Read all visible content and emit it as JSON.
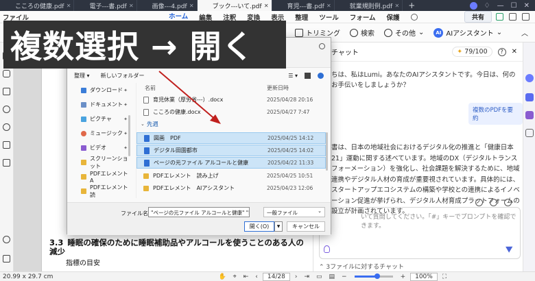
{
  "tabs": [
    {
      "label": "こころの健康.pdf",
      "active": false
    },
    {
      "label": "電子---書.pdf",
      "active": false
    },
    {
      "label": "画像---4.pdf",
      "active": false
    },
    {
      "label": "ブック---いて.pdf",
      "active": true
    },
    {
      "label": "育児---書.pdf",
      "active": false
    },
    {
      "label": "就業規則例.pdf",
      "active": false
    }
  ],
  "ribbon": {
    "file_label": "ファイル",
    "items": [
      "ホーム",
      "編集",
      "注釈",
      "変換",
      "表示",
      "整理",
      "ツール",
      "フォーム",
      "保護"
    ],
    "share_label": "共有"
  },
  "toolbar": {
    "trimming": "トリミング",
    "search": "検索",
    "other": "その他",
    "ai_badge": "AI",
    "ai_assistant": "AIアシスタント"
  },
  "caption": "複数選択 → 開く",
  "dialog": {
    "cmd_organize": "整理",
    "cmd_new_folder": "新しいフォルダー",
    "nav_items": [
      {
        "label": "ダウンロード",
        "color": "#3b7dd8"
      },
      {
        "label": "ドキュメント",
        "color": "#6a8fc7"
      },
      {
        "label": "ピクチャ",
        "color": "#4aa3df"
      },
      {
        "label": "ミュージック",
        "color": "#e0684a"
      },
      {
        "label": "ビデオ",
        "color": "#8a5cd0"
      },
      {
        "label": "スクリーンショット",
        "color": "#e8b53a"
      },
      {
        "label": "PDFエレメント A",
        "color": "#e8b53a"
      },
      {
        "label": "PDFエレメント 読",
        "color": "#e8b53a"
      },
      {
        "label": "PDFエレメント",
        "color": "#e8b53a"
      }
    ],
    "col_name": "名前",
    "col_date": "更新日時",
    "files_before": [
      {
        "name": "育児休業（厚労省---）.docx",
        "date": "2025/04/28 20:16"
      },
      {
        "name": "こころの健康.docx",
        "date": "2025/04/27 7:47"
      }
    ],
    "group_label": "先週",
    "files_after": [
      {
        "name": "図画　PDF",
        "date": "2025/04/25 14:12",
        "selected": true,
        "type": "pdf"
      },
      {
        "name": "デジタル田園都市",
        "date": "2025/04/25 14:02",
        "selected": true,
        "type": "pdf"
      },
      {
        "name": "ページの元ファイル アルコールと健康",
        "date": "2025/04/22 11:33",
        "selected": true,
        "type": "pdf"
      },
      {
        "name": "PDFエレメント　読み上げ",
        "date": "2025/04/25 10:51",
        "selected": false,
        "type": "folder"
      },
      {
        "name": "PDFエレメント　AIアシスタント",
        "date": "2025/04/23 12:06",
        "selected": false,
        "type": "folder"
      }
    ],
    "filename_label": "ファイル名(N):",
    "filename_value": "\"ページの元ファイル アルコールと健康\" \"図",
    "filetype_value": "一般ファイル",
    "open_label": "開く(O)",
    "cancel_label": "キャンセル"
  },
  "document": {
    "heading_num": "3.3",
    "heading": "睡眠の確保のために睡眠補助品やアルコールを使うことのある人の減少",
    "sub": "指標の目安"
  },
  "ai_panel": {
    "title": "チャット",
    "credits": "79/100",
    "intro": "ちは、私はLumi。あなたのAIアシスタントです。今日は、何のお手伝いをしましょうか？",
    "chip": "複数のPDFを要約",
    "body": "書は、日本の地域社会におけるデジタル化の推進と「健康日本21」運動に関する述べています。地域のDX（デジタルトランスフォーメーション）を強化し、社会課題を解決するために、地域連携やデジタル人材の育成が重要視されています。具体的には、スタートアップエコシステムの構築や学校との連携によるイノベーション促進が挙げられ、デジタル人材育成プラットフォームの設立が計画されています。",
    "input_placeholder": "いて質問してください。「#」キーでプロンプトを確認できます。",
    "footer": "3ファイルに対するチャット"
  },
  "statusbar": {
    "dimensions": "20.99 x 29.7 cm",
    "page_current": "14",
    "page_total": "/28",
    "zoom": "100%",
    "zoom_level": 0.6
  }
}
